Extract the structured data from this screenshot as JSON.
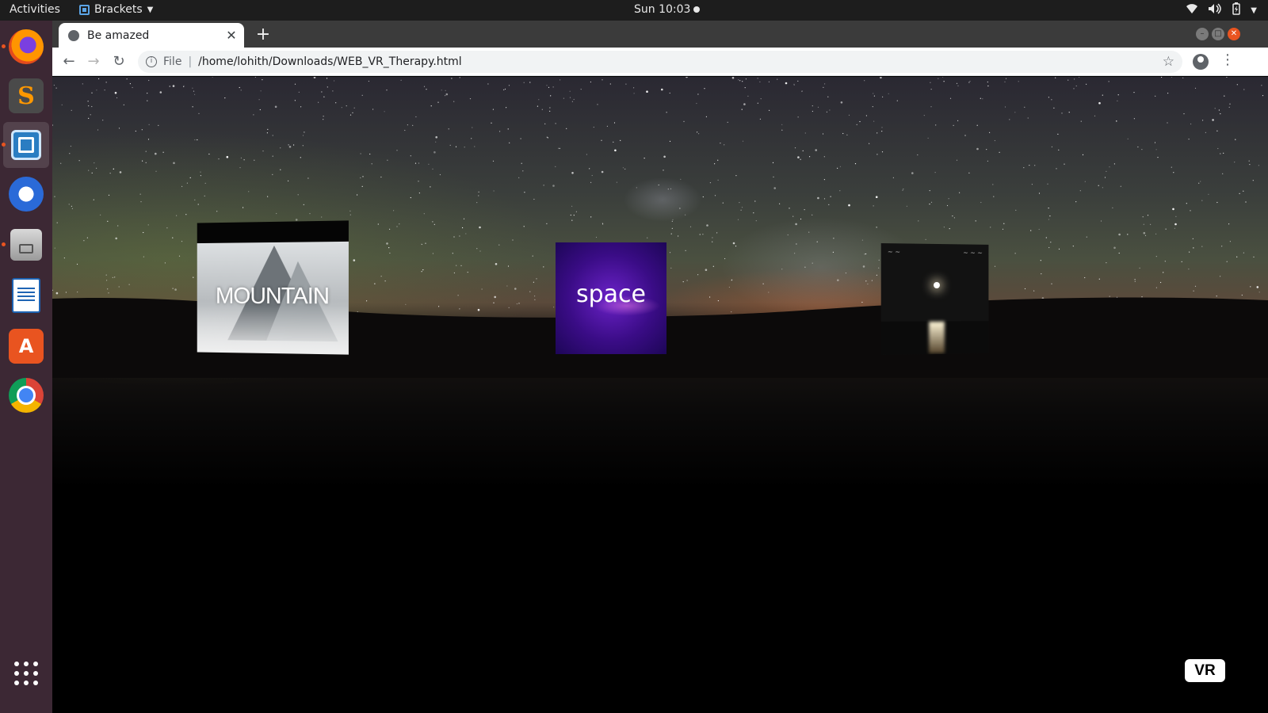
{
  "topbar": {
    "activities": "Activities",
    "app_name": "Brackets",
    "clock": "Sun 10:03"
  },
  "dock": {
    "items": [
      {
        "name": "Firefox",
        "icon": "firefox-icon",
        "running": true
      },
      {
        "name": "Sublime Text",
        "icon": "sublime-text-icon",
        "running": false
      },
      {
        "name": "Brackets",
        "icon": "brackets-icon",
        "running": true,
        "active": true
      },
      {
        "name": "Thunderbird",
        "icon": "thunderbird-icon",
        "running": false
      },
      {
        "name": "Files",
        "icon": "files-icon",
        "running": true
      },
      {
        "name": "LibreOffice Writer",
        "icon": "writer-icon",
        "running": false
      },
      {
        "name": "Ubuntu Software",
        "icon": "software-store-icon",
        "running": false
      },
      {
        "name": "Google Chrome",
        "icon": "chrome-icon",
        "running": false
      },
      {
        "name": "Show Applications",
        "icon": "app-grid-icon",
        "running": false
      }
    ]
  },
  "browser": {
    "tab_title": "Be amazed",
    "new_tab": "+",
    "omnibox": {
      "scheme_label": "File",
      "url": "/home/lohith/Downloads/WEB_VR_Therapy.html"
    }
  },
  "scene": {
    "panels": [
      {
        "id": "mountain",
        "label": "MOUNTAIN"
      },
      {
        "id": "space",
        "label": "space"
      },
      {
        "id": "night",
        "label": ""
      }
    ],
    "vr_button": "VR"
  },
  "colors": {
    "ubuntu_orange": "#e95420",
    "dock_bg": "#3c2834",
    "topbar_bg": "#1d1d1d",
    "tabstrip_bg": "#3b3b3b",
    "space_purple": "#6b22c8"
  }
}
